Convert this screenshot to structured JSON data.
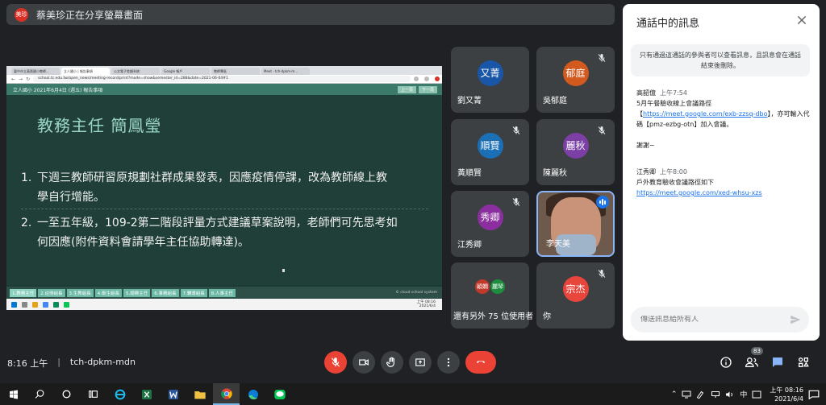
{
  "presenter": {
    "avatar_text": "美珍",
    "avatar_color": "#d93025",
    "message": "蔡美珍正在分享螢幕畫面"
  },
  "shared_screen": {
    "browser_tabs": [
      "臺中市立黃厝國小教師...",
      "立人國小 | 報告事項",
      "公文電子差額系統",
      "Google 帳戶",
      "教師專區",
      "Meet - tch-dpkm-m..."
    ],
    "address": "school.tc.edu.tw/open_news/meeting-record/print?mode=show&semester_id=288&date=2021-06-04#1",
    "site_title": "立人國小 2021年6月4日 (週五) 報告事項",
    "nav_prev": "上一頁",
    "nav_next": "下一頁",
    "slide": {
      "heading": "教務主任 簡鳳瑩",
      "item1_num": "1.",
      "item1_line1": "下週三教師研習原規劃社群成果發表，因應疫情停課，改為教師線上教",
      "item1_line2": "學自行增能。",
      "item2_num": "2.",
      "item2_line1": "一至五年級，109-2第二階段評量方式建議草案說明，老師們可先思考如",
      "item2_line2": "何因應(附件資料會請學年主任協助轉達)。"
    },
    "bottom_tabs": [
      "1.教務主任",
      "2.註冊組長",
      "3.生教組長",
      "4.衛生組長",
      "5.總務主任",
      "6.事務組長",
      "7.輔導組長",
      "8.人事主任"
    ],
    "footer": "© cloud school system",
    "mini_clock_time": "上午 08:16",
    "mini_clock_date": "2021/6/4"
  },
  "participants": [
    {
      "name": "劉又菁",
      "initials": "又菁",
      "color": "#1a56a8",
      "muted": false
    },
    {
      "name": "吳郁庭",
      "initials": "郁庭",
      "color": "#d35a1f",
      "muted": true
    },
    {
      "name": "黃順賢",
      "initials": "順賢",
      "color": "#1a6fb5",
      "muted": true
    },
    {
      "name": "陳麗秋",
      "initials": "麗秋",
      "color": "#7b3fa6",
      "muted": true
    },
    {
      "name": "江秀卿",
      "initials": "秀卿",
      "color": "#8b2fa0",
      "muted": true
    },
    {
      "name": "李天美",
      "initials": "",
      "color": "#6d5a4c",
      "muted": false
    },
    {
      "name": "還有另外 75 位使用者",
      "initials": "",
      "color": "",
      "muted": false
    },
    {
      "name": "你",
      "initials": "宗杰",
      "color": "#e8453c",
      "muted": true
    }
  ],
  "multi_avatars": [
    {
      "text": "穎嫻",
      "color": "#c0392b"
    },
    {
      "text": "麗琴",
      "color": "#1e8e3e"
    }
  ],
  "chat": {
    "title": "通話中的訊息",
    "notice": "只有通過這通話的參與者可以查看訊息，且訊息會在通話結束後刪除。",
    "messages": [
      {
        "sender": "高韶億",
        "time": "上午7:54",
        "line1": "5月午餐驗收線上會議路徑",
        "bracket_open": "【",
        "link": "https://meet.google.com/exb-zzsq-dbo",
        "line2_rest": "】，亦可輸入代碼【pmz-ezbg-otn】加入會議。",
        "line3": "謝謝~"
      },
      {
        "sender": "江秀卿",
        "time": "上午8:00",
        "line1": "戶外教育驗收會議路徑如下",
        "link": "https://meet.google.com/xed-whsu-xzs"
      }
    ],
    "input_placeholder": "傳送訊息給所有人"
  },
  "meeting": {
    "time": "8:16 上午",
    "separator": "|",
    "code": "tch-dpkm-mdn",
    "participant_count": "83"
  },
  "colors": {
    "leave_red": "#ea4335",
    "accent_blue": "#8ab4f8",
    "link_blue": "#1a73e8"
  },
  "taskbar": {
    "ime": "中",
    "time": "上午 08:16",
    "date": "2021/6/4"
  }
}
